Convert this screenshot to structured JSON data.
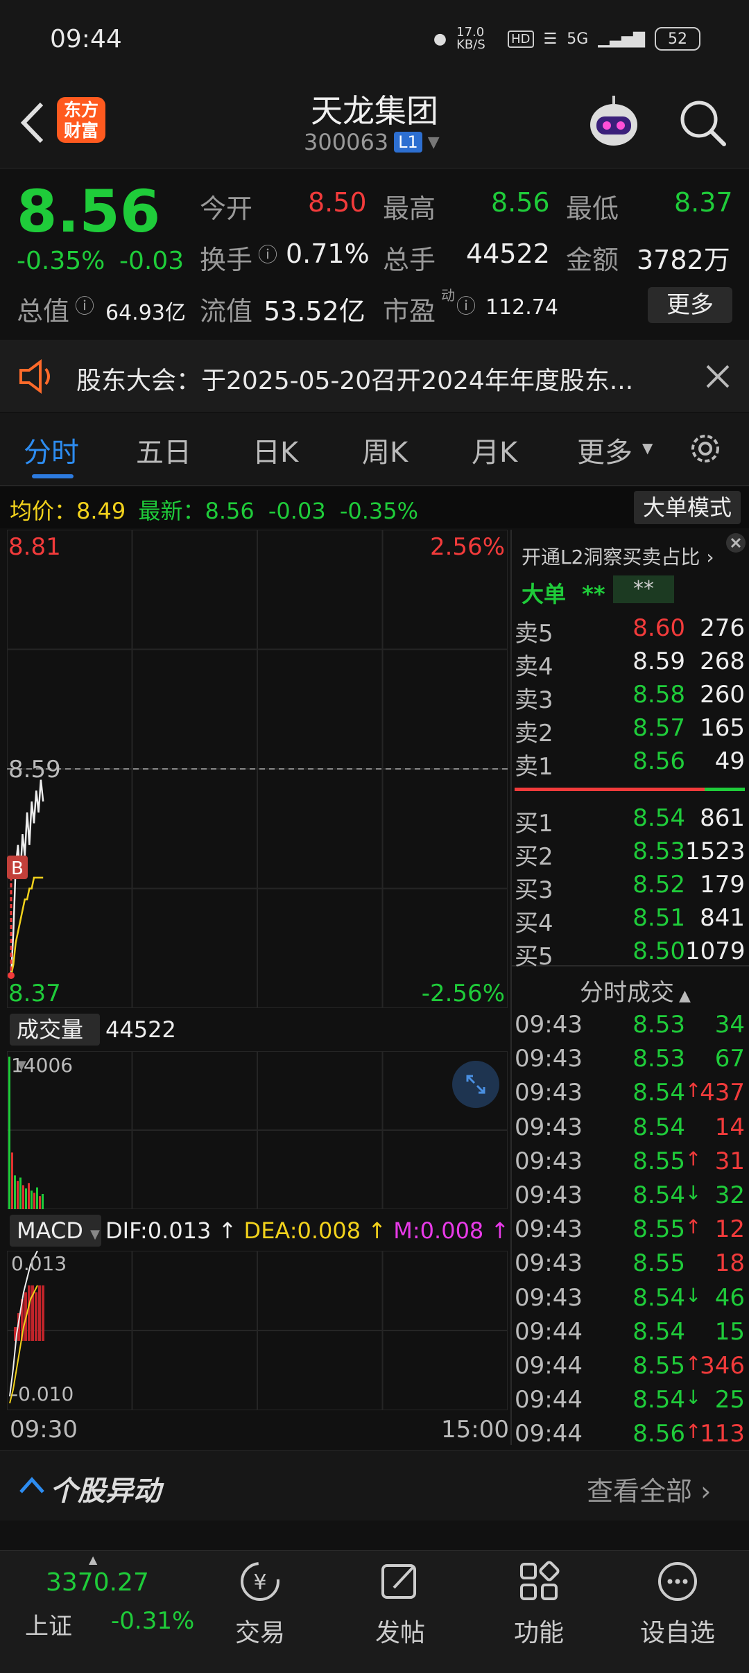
{
  "status_bar": {
    "time": "09:44",
    "net_speed": "17.0 KB/S",
    "hd": "HD",
    "signal": "5G",
    "battery": "52"
  },
  "header": {
    "stock_name": "天龙集团",
    "stock_code": "300063",
    "level": "L1",
    "logo_line1": "东方",
    "logo_line2": "财富"
  },
  "quote": {
    "last_price": "8.56",
    "change_pct": "-0.35%",
    "change_abs": "-0.03",
    "open_label": "今开",
    "open": "8.50",
    "high_label": "最高",
    "high": "8.56",
    "low_label": "最低",
    "low": "8.37",
    "turnover_label": "换手",
    "turnover": "0.71%",
    "volume_label": "总手",
    "volume": "44522",
    "amount_label": "金额",
    "amount": "3782万",
    "mktcap_label": "总值",
    "mktcap": "64.93亿",
    "float_label": "流值",
    "float_cap": "53.52亿",
    "pe_label": "市盈",
    "pe_sup": "动",
    "pe": "112.74",
    "more_label": "更多"
  },
  "notice": {
    "text": "股东大会：于2025-05-20召开2024年年度股东..."
  },
  "tabs": [
    "分时",
    "五日",
    "日K",
    "周K",
    "月K",
    "更多"
  ],
  "chart_info": {
    "avg_label": "均价：",
    "avg": "8.49",
    "latest_label": "最新：",
    "latest": "8.56",
    "latest_chg": "-0.03",
    "latest_pct": "-0.35%",
    "big_order_mode": "大单模式"
  },
  "chart_data": {
    "type": "line",
    "y_top": "8.81",
    "y_top_pct": "2.56%",
    "y_mid": "8.59",
    "y_bottom": "8.37",
    "y_bottom_pct": "-2.56%",
    "ylim": [
      8.37,
      8.81
    ],
    "x_start": "09:30",
    "x_end": "15:00",
    "price": [
      8.4,
      8.44,
      8.5,
      8.52,
      8.49,
      8.53,
      8.51,
      8.55,
      8.52,
      8.56,
      8.54,
      8.57,
      8.55,
      8.58,
      8.56
    ],
    "average": [
      8.4,
      8.41,
      8.43,
      8.44,
      8.45,
      8.46,
      8.47,
      8.47,
      8.48,
      8.48,
      8.49,
      8.49,
      8.49,
      8.49,
      8.49
    ],
    "marker": "B",
    "volume_label": "成交量",
    "volume_total": "44522",
    "volume_max_label": "14006",
    "volume_max": 14006,
    "volume_bars": [
      14006,
      5200,
      3100,
      2600,
      2900,
      2200,
      1900,
      2400,
      1700,
      1500,
      2000,
      1200,
      1400
    ],
    "macd_label": "MACD",
    "dif_label": "DIF:0.013",
    "dea_label": "DEA:0.008",
    "m_label": "M:0.008",
    "macd_top": "0.013",
    "macd_bottom": "-0.010",
    "macd_ylim": [
      -0.01,
      0.013
    ],
    "dif": [
      -0.008,
      -0.004,
      0.001,
      0.004,
      0.007,
      0.009,
      0.011,
      0.012,
      0.013
    ],
    "dea": [
      -0.009,
      -0.007,
      -0.004,
      -0.001,
      0.002,
      0.004,
      0.006,
      0.007,
      0.008
    ],
    "macd_hist": [
      0.002,
      0.004,
      0.006,
      0.007,
      0.008,
      0.008,
      0.007,
      0.008,
      0.008
    ]
  },
  "order_book": {
    "l2_link": "开通L2洞察买卖占比",
    "big_order_label": "大单",
    "big_order_a": "**",
    "big_order_b": "**",
    "asks": [
      {
        "label": "卖5",
        "price": "8.60",
        "vol": "276",
        "color": "#f23b3b"
      },
      {
        "label": "卖4",
        "price": "8.59",
        "vol": "268",
        "color": "#eeeeee"
      },
      {
        "label": "卖3",
        "price": "8.58",
        "vol": "260",
        "color": "#1fcc3a"
      },
      {
        "label": "卖2",
        "price": "8.57",
        "vol": "165",
        "color": "#1fcc3a"
      },
      {
        "label": "卖1",
        "price": "8.56",
        "vol": "49",
        "color": "#1fcc3a"
      }
    ],
    "bids": [
      {
        "label": "买1",
        "price": "8.54",
        "vol": "861",
        "color": "#1fcc3a"
      },
      {
        "label": "买2",
        "price": "8.53",
        "vol": "1523",
        "color": "#1fcc3a"
      },
      {
        "label": "买3",
        "price": "8.52",
        "vol": "179",
        "color": "#1fcc3a"
      },
      {
        "label": "买4",
        "price": "8.51",
        "vol": "841",
        "color": "#1fcc3a"
      },
      {
        "label": "买5",
        "price": "8.50",
        "vol": "1079",
        "color": "#1fcc3a"
      }
    ]
  },
  "ticks": {
    "title": "分时成交",
    "rows": [
      {
        "time": "09:43",
        "price": "8.53",
        "arrow": "",
        "vol": "34",
        "pcolor": "#1fcc3a",
        "vcolor": "#1fcc3a"
      },
      {
        "time": "09:43",
        "price": "8.53",
        "arrow": "",
        "vol": "67",
        "pcolor": "#1fcc3a",
        "vcolor": "#1fcc3a"
      },
      {
        "time": "09:43",
        "price": "8.54",
        "arrow": "↑",
        "vol": "437",
        "pcolor": "#1fcc3a",
        "vcolor": "#f23b3b"
      },
      {
        "time": "09:43",
        "price": "8.54",
        "arrow": "",
        "vol": "14",
        "pcolor": "#1fcc3a",
        "vcolor": "#f23b3b"
      },
      {
        "time": "09:43",
        "price": "8.55",
        "arrow": "↑",
        "vol": "31",
        "pcolor": "#1fcc3a",
        "vcolor": "#f23b3b"
      },
      {
        "time": "09:43",
        "price": "8.54",
        "arrow": "↓",
        "vol": "32",
        "pcolor": "#1fcc3a",
        "vcolor": "#1fcc3a"
      },
      {
        "time": "09:43",
        "price": "8.55",
        "arrow": "↑",
        "vol": "12",
        "pcolor": "#1fcc3a",
        "vcolor": "#f23b3b"
      },
      {
        "time": "09:43",
        "price": "8.55",
        "arrow": "",
        "vol": "18",
        "pcolor": "#1fcc3a",
        "vcolor": "#f23b3b"
      },
      {
        "time": "09:43",
        "price": "8.54",
        "arrow": "↓",
        "vol": "46",
        "pcolor": "#1fcc3a",
        "vcolor": "#1fcc3a"
      },
      {
        "time": "09:44",
        "price": "8.54",
        "arrow": "",
        "vol": "15",
        "pcolor": "#1fcc3a",
        "vcolor": "#1fcc3a"
      },
      {
        "time": "09:44",
        "price": "8.55",
        "arrow": "↑",
        "vol": "346",
        "pcolor": "#1fcc3a",
        "vcolor": "#f23b3b"
      },
      {
        "time": "09:44",
        "price": "8.54",
        "arrow": "↓",
        "vol": "25",
        "pcolor": "#1fcc3a",
        "vcolor": "#1fcc3a"
      },
      {
        "time": "09:44",
        "price": "8.56",
        "arrow": "↑",
        "vol": "113",
        "pcolor": "#1fcc3a",
        "vcolor": "#f23b3b"
      }
    ]
  },
  "movement": {
    "title": "个股异动",
    "view_all": "查看全部"
  },
  "bottom_nav": {
    "index_value": "3370.27",
    "index_name": "上证",
    "index_change": "-0.31%",
    "items": [
      "交易",
      "发帖",
      "功能",
      "设自选"
    ]
  }
}
